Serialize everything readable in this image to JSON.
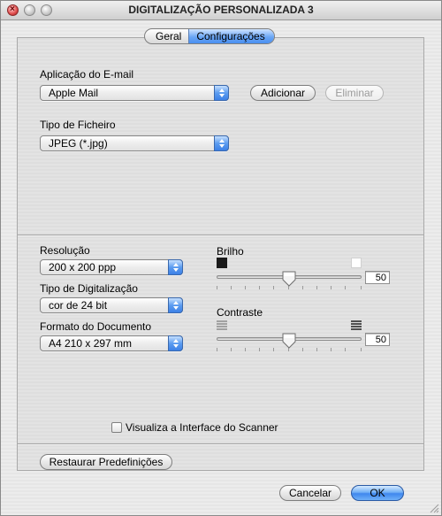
{
  "window": {
    "title": "DIGITALIZAÇÃO PERSONALIZADA 3"
  },
  "tabs": [
    {
      "label": "Geral",
      "selected": false
    },
    {
      "label": "Configurações",
      "selected": true
    }
  ],
  "email": {
    "label": "Aplicação do E-mail",
    "value": "Apple Mail",
    "add_label": "Adicionar",
    "remove_label": "Eliminar"
  },
  "file_type": {
    "label": "Tipo de Ficheiro",
    "value": "JPEG (*.jpg)"
  },
  "resolution": {
    "label": "Resolução",
    "value": "200 x 200 ppp"
  },
  "scan_type": {
    "label": "Tipo de Digitalização",
    "value": "cor de 24 bit"
  },
  "document_size": {
    "label": "Formato do Documento",
    "value": "A4  210 x 297 mm"
  },
  "brightness": {
    "label": "Brilho",
    "value": "50",
    "level": 0.5
  },
  "contrast": {
    "label": "Contraste",
    "value": "50",
    "level": 0.5
  },
  "scanner_interface": {
    "label": "Visualiza a Interface do Scanner",
    "checked": false
  },
  "buttons": {
    "restore": "Restaurar Predefinições",
    "cancel": "Cancelar",
    "ok": "OK"
  },
  "colors": {
    "accent": "#4a8ff0",
    "disabled_text": "#9a9a9a"
  }
}
